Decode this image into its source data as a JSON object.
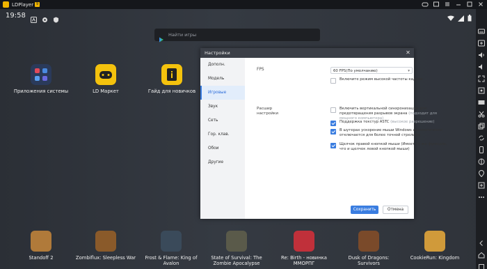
{
  "titlebar": {
    "app_name": "LDPlayer",
    "version_badge": "9",
    "buttons": [
      "gamepad-icon",
      "window-icon",
      "menu-icon",
      "minimize-icon",
      "maximize-icon",
      "close-icon"
    ]
  },
  "statusbar": {
    "time": "19:58"
  },
  "search": {
    "placeholder": "Найти игры"
  },
  "desktop_apps": [
    {
      "label": "Приложения системы",
      "color": "#2a3a5a"
    },
    {
      "label": "LD Маркет",
      "color": "#f4c20d"
    },
    {
      "label": "Гайд для новичков",
      "color": "#f4c20d"
    }
  ],
  "bottom_apps": [
    {
      "label": "Standoff 2",
      "color": "#b07a3a"
    },
    {
      "label": "Zombiflux: Sleepless War",
      "color": "#8a5a2a"
    },
    {
      "label": "Frost & Flame: King of Avalon",
      "color": "#3a4a5a"
    },
    {
      "label": "State of Survival: The Zombie Apocalypse",
      "color": "#5a5a4a"
    },
    {
      "label": "Re: Birth - новинка ММОРПГ",
      "color": "#c0303a"
    },
    {
      "label": "Dusk of Dragons: Survivors",
      "color": "#7a4a2a"
    },
    {
      "label": "CookieRun: Kingdom",
      "color": "#d09a3a"
    }
  ],
  "dialog": {
    "title": "Настройки",
    "sidebar": [
      "Дополн.",
      "Модель",
      "Игровые",
      "Звук",
      "Сеть",
      "Гор. клав.",
      "Обои",
      "Другие"
    ],
    "active_index": 2,
    "fps_label": "FPS",
    "fps_value": "60 FPS(По умолчанию)",
    "high_fps_label": "Включите режим высокой частоты кадров",
    "extended_label": "Расшир настройки",
    "options": [
      {
        "text": "Включить вертикальной синхронизации для предотвращения разрывов экрана",
        "hint": "(подходит для мощного компьютера)",
        "checked": false
      },
      {
        "text": "Поддержка текстур ASTC",
        "hint": "(высокое разрешение)",
        "checked": true
      },
      {
        "text": "В шутерах ускорение мыши Windows автоматически отключается для более точной стрельбы",
        "hint": "",
        "checked": true
      },
      {
        "text": "Щелчок правой кнопкой мыши (Имеет ту же функцию, что и щелчок левой кнопкой мыши)",
        "hint": "",
        "checked": true
      }
    ],
    "save_label": "Сохранить",
    "cancel_label": "Отмена"
  }
}
